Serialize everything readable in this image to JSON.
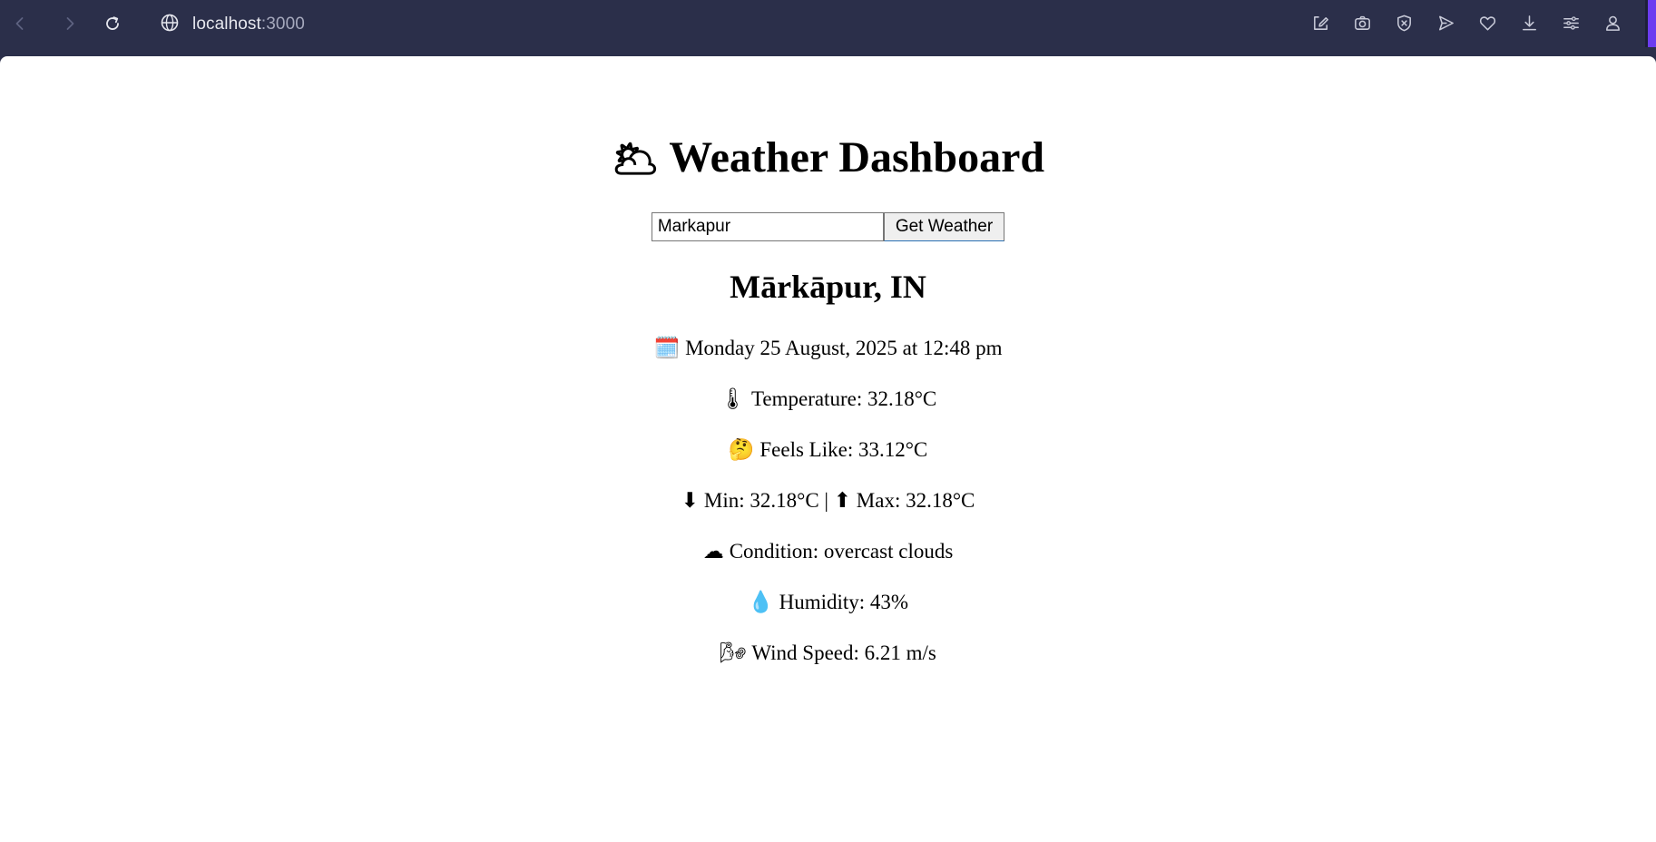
{
  "browser": {
    "url_host": "localhost",
    "url_port": ":3000",
    "accent_color": "#6c3cf0"
  },
  "app": {
    "title": "Weather Dashboard",
    "title_icon": "🌥",
    "search": {
      "value": "Markapur",
      "button_label": "Get Weather"
    },
    "location": "Mārkāpur, IN",
    "details": [
      {
        "icon": "🗓️",
        "icon_name": "calendar-icon",
        "text": "Monday 25 August, 2025 at 12:48 pm"
      },
      {
        "icon": "🌡",
        "icon_name": "thermometer-icon",
        "text": "Temperature: 32.18°C"
      },
      {
        "icon": "🤔",
        "icon_name": "thinking-face-icon",
        "text": "Feels Like: 33.12°C"
      },
      {
        "icon": "⬇",
        "icon_name": "down-arrow-icon",
        "text": "Min: 32.18°C | ⬆ Max: 32.18°C"
      },
      {
        "icon": "☁",
        "icon_name": "cloud-icon",
        "text": "Condition: overcast clouds"
      },
      {
        "icon": "💧",
        "icon_name": "droplet-icon",
        "text": "Humidity: 43%"
      },
      {
        "icon": "🌬",
        "icon_name": "wind-icon",
        "text": "Wind Speed: 6.21 m/s"
      }
    ]
  }
}
